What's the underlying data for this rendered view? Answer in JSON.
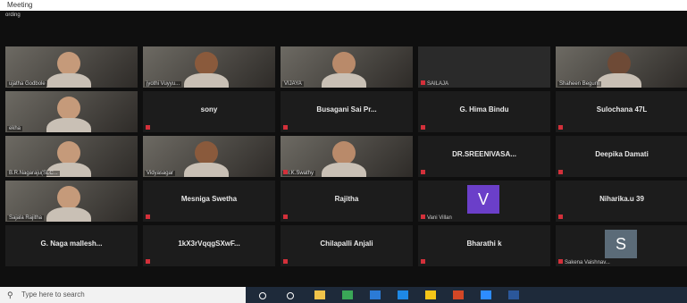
{
  "window": {
    "title": "Meeting",
    "subtitle": "ording"
  },
  "tiles": [
    {
      "name": "ujatha Godbole",
      "kind": "video",
      "row": 0,
      "col": 0
    },
    {
      "name": "jyothi Vuyyu...",
      "kind": "video",
      "row": 0,
      "col": 1
    },
    {
      "name": "VIJAYA",
      "kind": "video",
      "row": 0,
      "col": 2
    },
    {
      "name": "SAILAJA",
      "kind": "video-dark",
      "row": 0,
      "col": 3,
      "muted": true
    },
    {
      "name": "Shaheen Begum",
      "kind": "video",
      "row": 0,
      "col": 4
    },
    {
      "name": "ekha",
      "kind": "video",
      "row": 1,
      "col": 0
    },
    {
      "name": "sony",
      "kind": "name",
      "row": 1,
      "col": 1,
      "muted": true
    },
    {
      "name": "Busagani Sai Pr...",
      "kind": "name",
      "row": 1,
      "col": 2,
      "muted": true
    },
    {
      "name": "G. Hima Bindu",
      "kind": "name",
      "row": 1,
      "col": 3,
      "muted": true
    },
    {
      "name": "Sulochana 47L",
      "kind": "name",
      "row": 1,
      "col": 4,
      "muted": true
    },
    {
      "name": "B.R.Nagaraju(SLC...",
      "kind": "video",
      "row": 2,
      "col": 0,
      "active": true
    },
    {
      "name": "Vidyasagar",
      "kind": "video",
      "row": 2,
      "col": 1
    },
    {
      "name": "Dr.K.Swathy",
      "kind": "video",
      "row": 2,
      "col": 2,
      "muted": true
    },
    {
      "name": "DR.SREENIVASA...",
      "kind": "name",
      "row": 2,
      "col": 3,
      "muted": true
    },
    {
      "name": "Deepika Damati",
      "kind": "name",
      "row": 2,
      "col": 4,
      "muted": true
    },
    {
      "name": "Sajala Rajitha",
      "kind": "video",
      "row": 3,
      "col": 0
    },
    {
      "name": "Mesniga Swetha",
      "kind": "name",
      "row": 3,
      "col": 1,
      "muted": true
    },
    {
      "name": "Rajitha",
      "kind": "name",
      "row": 3,
      "col": 2,
      "muted": true
    },
    {
      "name": "Vani Villan",
      "kind": "avatar",
      "avatar": "V",
      "avatar_color": "#6b3fc9",
      "row": 3,
      "col": 3,
      "muted": true
    },
    {
      "name": "Niharika.u 39",
      "kind": "name",
      "row": 3,
      "col": 4,
      "muted": true
    },
    {
      "name": "G. Naga mallesh...",
      "kind": "name",
      "row": 4,
      "col": 0
    },
    {
      "name": "1kX3rVqqgSXwF...",
      "kind": "name",
      "row": 4,
      "col": 1,
      "muted": true
    },
    {
      "name": "Chilapalli Anjali",
      "kind": "name",
      "row": 4,
      "col": 2,
      "muted": true
    },
    {
      "name": "Bharathi k",
      "kind": "name",
      "row": 4,
      "col": 3,
      "muted": true
    },
    {
      "name": "Sakena Vaishnav...",
      "kind": "avatar",
      "avatar": "S",
      "avatar_color": "#5b6b78",
      "row": 4,
      "col": 4,
      "muted": true
    }
  ],
  "taskbar": {
    "search_placeholder": "Type here to search",
    "icons": [
      {
        "name": "cortana-icon",
        "color": "#ffffff"
      },
      {
        "name": "task-view-icon",
        "color": "#ffffff"
      },
      {
        "name": "file-explorer-icon",
        "color": "#f0c34a"
      },
      {
        "name": "chrome-icon",
        "color": "#3aa757"
      },
      {
        "name": "mail-icon",
        "color": "#2b7bd6"
      },
      {
        "name": "edge-icon",
        "color": "#1e88e5"
      },
      {
        "name": "store-icon",
        "color": "#f5c518"
      },
      {
        "name": "powerpoint-icon",
        "color": "#d24726"
      },
      {
        "name": "zoom-icon",
        "color": "#2d8cff"
      },
      {
        "name": "word-icon",
        "color": "#2b579a"
      }
    ]
  }
}
